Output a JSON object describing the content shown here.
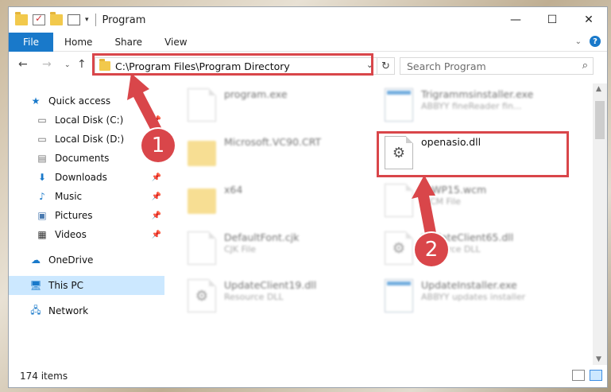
{
  "window": {
    "title": "Program"
  },
  "ribbon": {
    "tabs": [
      "File",
      "Home",
      "Share",
      "View"
    ]
  },
  "address": {
    "path": "C:\\Program Files\\Program Directory",
    "search_placeholder": "Search Program"
  },
  "sidebar": {
    "items": [
      {
        "label": "Quick access",
        "icon": "star-icon",
        "pinned": false
      },
      {
        "label": "Local Disk (C:)",
        "icon": "drive-icon",
        "pinned": true
      },
      {
        "label": "Local Disk (D:)",
        "icon": "drive-icon",
        "pinned": false
      },
      {
        "label": "Documents",
        "icon": "documents-icon",
        "pinned": true
      },
      {
        "label": "Downloads",
        "icon": "download-icon",
        "pinned": true
      },
      {
        "label": "Music",
        "icon": "music-icon",
        "pinned": true
      },
      {
        "label": "Pictures",
        "icon": "pictures-icon",
        "pinned": true
      },
      {
        "label": "Videos",
        "icon": "videos-icon",
        "pinned": true
      },
      {
        "label": "OneDrive",
        "icon": "cloud-icon",
        "pinned": false
      },
      {
        "label": "This PC",
        "icon": "pc-icon",
        "pinned": false,
        "selected": true
      },
      {
        "label": "Network",
        "icon": "network-icon",
        "pinned": false
      }
    ]
  },
  "files": [
    {
      "name": "program.exe",
      "desc": "",
      "type": "doc"
    },
    {
      "name": "Trigrammsinstaller.exe",
      "desc": "ABBYY fineReader fin...",
      "type": "exe"
    },
    {
      "name": "Microsoft.VC90.CRT",
      "desc": "",
      "type": "folder"
    },
    {
      "name": "openasio.dll",
      "desc": "",
      "type": "dll"
    },
    {
      "name": "x64",
      "desc": "",
      "type": "folder"
    },
    {
      "name": "ToWP15.wcm",
      "desc": "WCM File",
      "type": "doc"
    },
    {
      "name": "DefaultFont.cjk",
      "desc": "CJK File",
      "type": "doc"
    },
    {
      "name": "UpdateClient65.dll",
      "desc": "Resource DLL",
      "type": "dll"
    },
    {
      "name": "UpdateClient19.dll",
      "desc": "Resource DLL",
      "type": "dll"
    },
    {
      "name": "UpdateInstaller.exe",
      "desc": "ABBYY updates installer",
      "type": "exe"
    }
  ],
  "status": {
    "item_count": "174 items"
  },
  "annotations": {
    "badge1": "1",
    "badge2": "2",
    "accent": "#d9464a"
  }
}
